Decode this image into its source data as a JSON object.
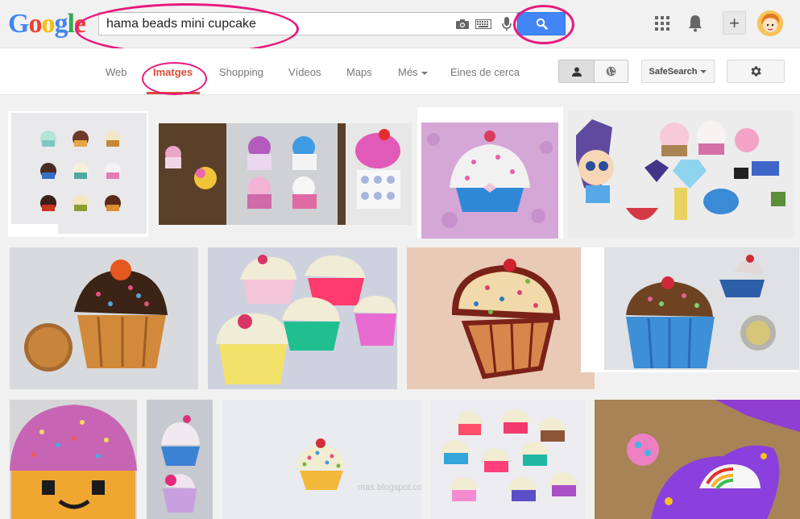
{
  "logo": {
    "letters": [
      "G",
      "o",
      "o",
      "g",
      "l",
      "e"
    ],
    "colors": [
      "#4285f4",
      "#ea4335",
      "#fbbc05",
      "#4285f4",
      "#34a853",
      "#ea4335"
    ]
  },
  "search": {
    "query": "hama beads mini cupcake"
  },
  "tabs": [
    {
      "label": "Web"
    },
    {
      "label": "Imatges"
    },
    {
      "label": "Shopping"
    },
    {
      "label": "Vídeos"
    },
    {
      "label": "Maps"
    },
    {
      "label": "Més"
    },
    {
      "label": "Eines de cerca"
    }
  ],
  "toolbar": {
    "safesearch_label": "SafeSearch",
    "share_symbol": "+"
  },
  "colors": {
    "accent": "#dd4b39",
    "search_button": "#4285f4",
    "annotation": "#e8187d"
  },
  "images": {
    "watermark": "mas.blogspot.com"
  }
}
